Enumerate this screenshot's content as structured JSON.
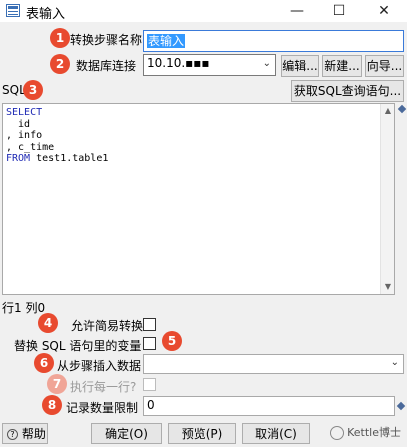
{
  "window": {
    "title": "表输入",
    "minimize": "—",
    "maximize": "☐",
    "close": "✕"
  },
  "badges": [
    "1",
    "2",
    "3",
    "4",
    "5",
    "6",
    "7",
    "8"
  ],
  "step_name": {
    "label": "转换步骤名称",
    "value": "表输入"
  },
  "db_connection": {
    "label": "数据库连接",
    "value": "10.10.▪▪▪",
    "edit": "编辑...",
    "new": "新建...",
    "wizard": "向导..."
  },
  "sql": {
    "label": "SQL",
    "get_button": "获取SQL查询语句...",
    "lines": [
      {
        "kw": "SELECT",
        "text": ""
      },
      {
        "kw": "",
        "text": "  id"
      },
      {
        "kw": "",
        "text": ", info"
      },
      {
        "kw": "",
        "text": ", c_time"
      },
      {
        "kw": "FROM",
        "text": " test1.table1"
      }
    ]
  },
  "cursor_pos": "行1 列0",
  "lazy_conversion": {
    "label": "允许简易转换"
  },
  "replace_vars": {
    "label": "替换 SQL 语句里的变量"
  },
  "insert_from_step": {
    "label": "从步骤插入数据",
    "value": ""
  },
  "execute_each_row": {
    "label": "执行每一行?"
  },
  "limit": {
    "label": "记录数量限制",
    "value": "0"
  },
  "footer": {
    "help": "帮助",
    "ok": "确定(O)",
    "preview": "预览(P)",
    "cancel": "取消(C)"
  },
  "watermark": "Kettle博士",
  "colors": {
    "badge": "#e84a2f",
    "selection": "#3399ff",
    "sql_keyword": "#1f2ab4"
  }
}
